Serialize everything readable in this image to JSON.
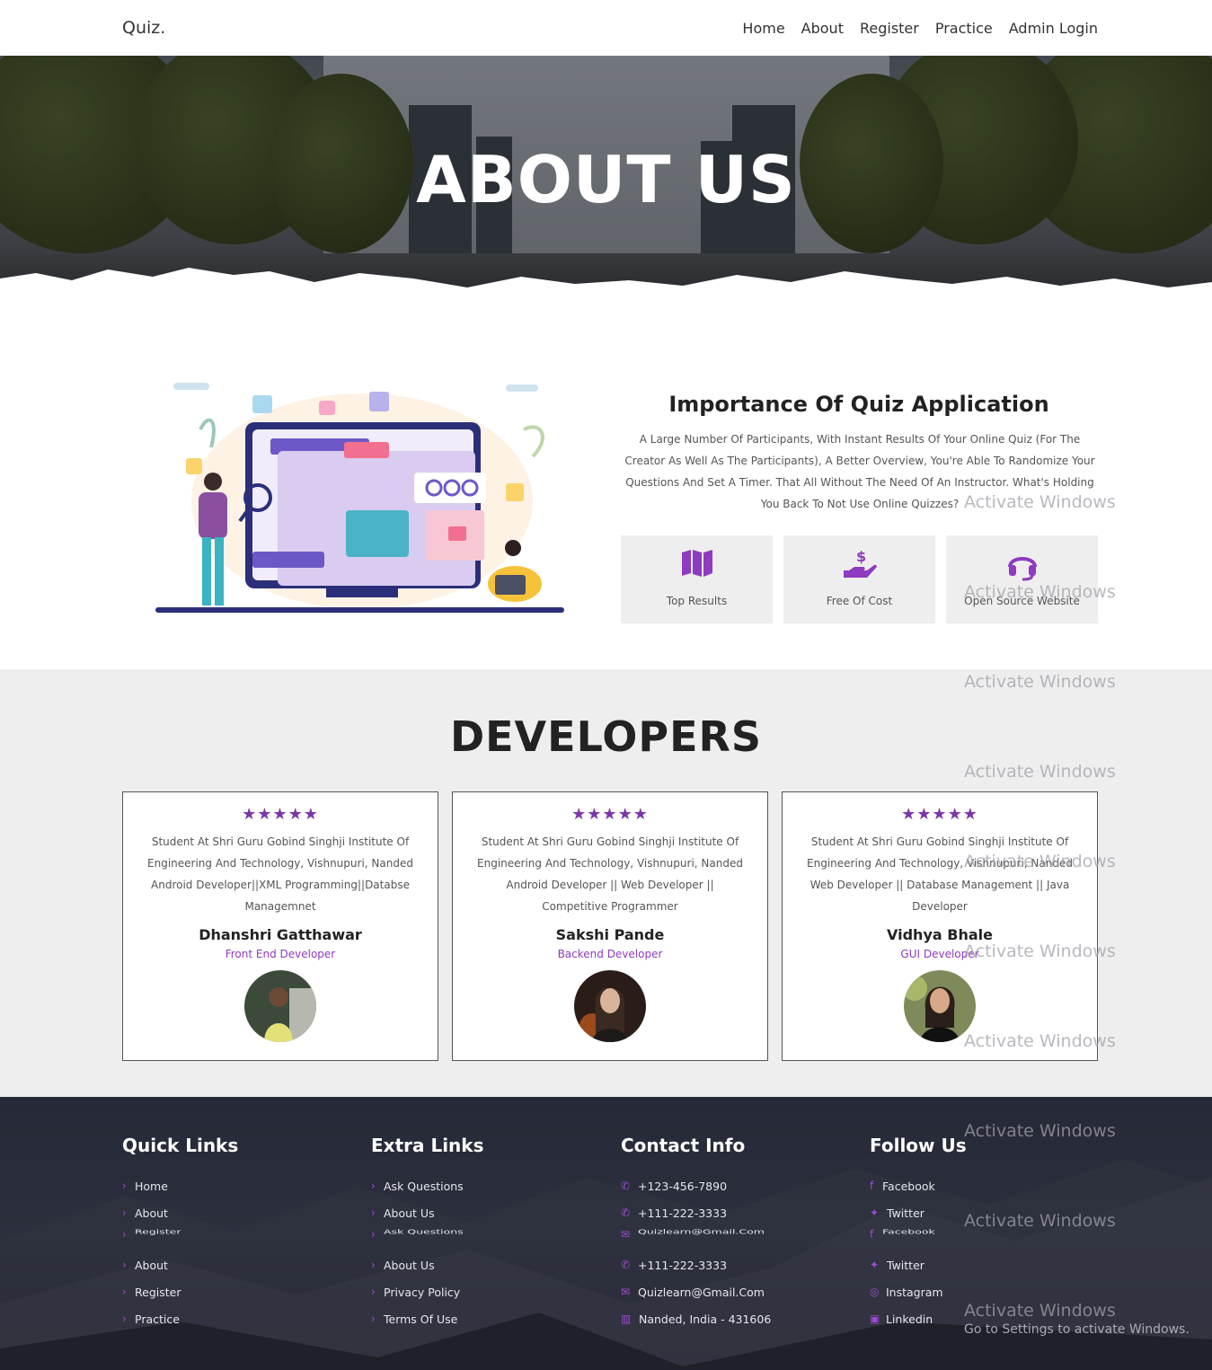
{
  "header": {
    "logo": "Quiz.",
    "nav": [
      "Home",
      "About",
      "Register",
      "Practice",
      "Admin Login"
    ]
  },
  "hero": {
    "title": "ABOUT US"
  },
  "about": {
    "title": "Importance Of Quiz Application",
    "text": "A Large Number Of Participants, With Instant Results Of Your Online Quiz (For The Creator As Well As The Participants), A Better Overview, You're Able To Randomize Your Questions And Set A Timer. That All Without The Need Of An Instructor. What's Holding You Back To Not Use Online Quizzes?",
    "features": [
      {
        "icon": "map-icon",
        "label": "Top Results"
      },
      {
        "icon": "hand-dollar-icon",
        "label": "Free Of Cost"
      },
      {
        "icon": "headset-icon",
        "label": "Open Source Website"
      }
    ]
  },
  "developers": {
    "title": "DEVELOPERS",
    "stars": "★★★★★",
    "cards": [
      {
        "desc": "Student At Shri Guru Gobind Singhji Institute Of Engineering And Technology, Vishnupuri, Nanded Android Developer||XML Programming||Databse Managemnet",
        "name": "Dhanshri Gatthawar",
        "role": "Front End Developer"
      },
      {
        "desc": "Student At Shri Guru Gobind Singhji Institute Of Engineering And Technology, Vishnupuri, Nanded Android Developer || Web Developer || Competitive Programmer",
        "name": "Sakshi Pande",
        "role": "Backend Developer"
      },
      {
        "desc": "Student At Shri Guru Gobind Singhji Institute Of Engineering And Technology, Vishnupuri, Nanded Web Developer || Database Management || Java Developer",
        "name": "Vidhya Bhale",
        "role": "GUI Developer"
      }
    ]
  },
  "footer": {
    "quick": {
      "title": "Quick Links",
      "items": [
        "Home",
        "About",
        "Register",
        "About",
        "Register",
        "Practice"
      ]
    },
    "extra": {
      "title": "Extra Links",
      "items": [
        "Ask Questions",
        "About Us",
        "Ask Questions",
        "About Us",
        "Privacy Policy",
        "Terms Of Use"
      ]
    },
    "contact": {
      "title": "Contact Info",
      "items": [
        "+123-456-7890",
        "+111-222-3333",
        "Quizlearn@Gmail.Com",
        "+111-222-3333",
        "Quizlearn@Gmail.Com",
        "Nanded, India - 431606"
      ]
    },
    "follow": {
      "title": "Follow Us",
      "items": [
        "Facebook",
        "Twitter",
        "Facebook",
        "Twitter",
        "Instagram",
        "Linkedin"
      ]
    }
  },
  "watermark": {
    "text": "Activate Windows",
    "sub": "Go to Settings to activate Windows."
  },
  "colors": {
    "accent": "#8e3bbf",
    "footer_bg": "#262937",
    "section_bg": "#eeeeee"
  }
}
